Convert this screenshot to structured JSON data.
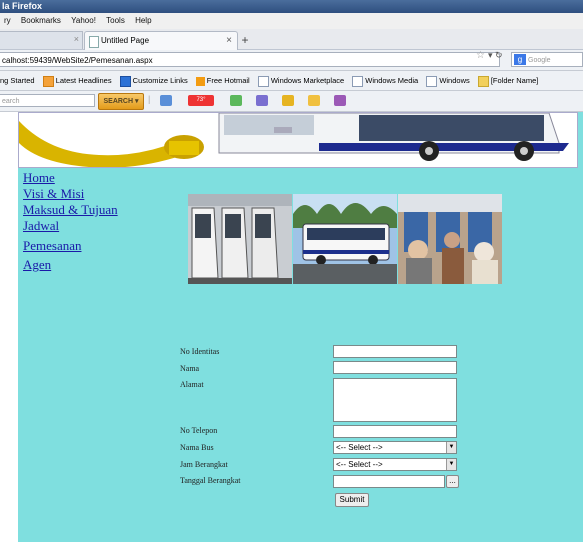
{
  "window": {
    "title": "la Firefox"
  },
  "menubar": {
    "items": [
      "ry",
      "Bookmarks",
      "Yahoo!",
      "Tools",
      "Help"
    ]
  },
  "tabs": {
    "active_label": "Untitled Page"
  },
  "address": {
    "url": "calhost:59439/WebSite2/Pemesanan.aspx",
    "search_placeholder": "Google"
  },
  "bookmarks": [
    "ng Started",
    "Latest Headlines",
    "Customize Links",
    "Free Hotmail",
    "Windows Marketplace",
    "Windows Media",
    "Windows",
    "[Folder Name]"
  ],
  "yahoo_toolbar": {
    "search_placeholder": "earch",
    "search_button": "SEARCH",
    "badge": "73°"
  },
  "nav": {
    "links": [
      "Home",
      "Visi & Misi",
      "Maksud & Tujuan",
      "Jadwal",
      "Pemesanan",
      "Agen"
    ]
  },
  "form": {
    "labels": [
      "No Identitas",
      "Nama",
      "Alamat",
      "No Telepon",
      "Nama Bus",
      "Jam Berangkat",
      "Tanggal Berangkat"
    ],
    "select_default": "<-- Select -->",
    "date_button": "...",
    "submit": "Submit"
  },
  "colors": {
    "page_background": "#7fdfdf",
    "link": "#1a1aa8"
  }
}
